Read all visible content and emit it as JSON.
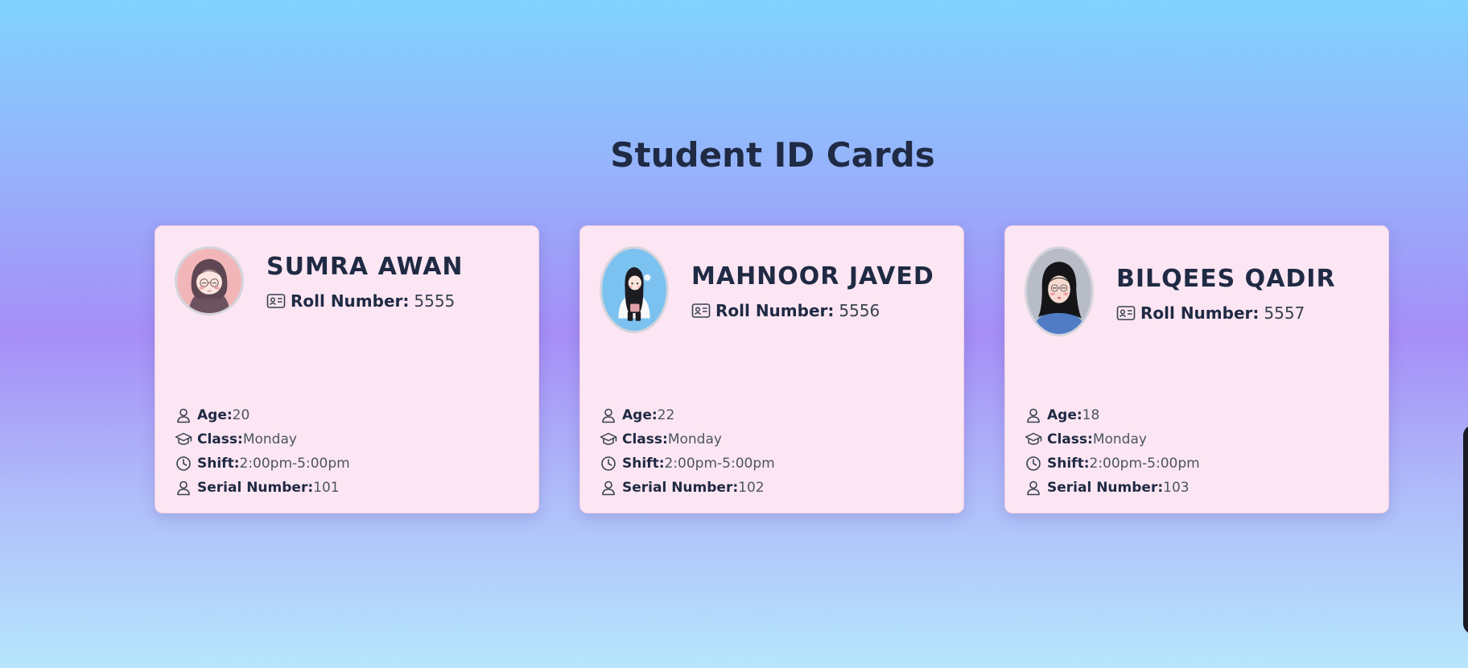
{
  "page": {
    "title": "Student ID Cards"
  },
  "labels": {
    "roll": "Roll Number:",
    "age": "Age:",
    "class": "Class:",
    "shift": "Shift:",
    "serial": "Serial Number:"
  },
  "students": [
    {
      "name": "SUMRA AWAN",
      "roll_number": "5555",
      "age": "20",
      "class": "Monday",
      "shift": "2:00pm-5:00pm",
      "serial_number": "101",
      "avatar_bg": "#f2b6b8"
    },
    {
      "name": "MAHNOOR JAVED",
      "roll_number": "5556",
      "age": "22",
      "class": "Monday",
      "shift": "2:00pm-5:00pm",
      "serial_number": "102",
      "avatar_bg": "#7cc2f0"
    },
    {
      "name": "BILQEES QADIR",
      "roll_number": "5557",
      "age": "18",
      "class": "Monday",
      "shift": "2:00pm-5:00pm",
      "serial_number": "103",
      "avatar_bg": "#b7bcc6"
    }
  ],
  "icons": {
    "roll": "id-card-icon",
    "age": "user-icon",
    "class": "graduation-cap-icon",
    "shift": "clock-icon",
    "serial": "user-icon"
  },
  "colors": {
    "card_bg": "#fde6f3",
    "text_dark": "#1f2a44",
    "text_value": "#4b5563"
  }
}
